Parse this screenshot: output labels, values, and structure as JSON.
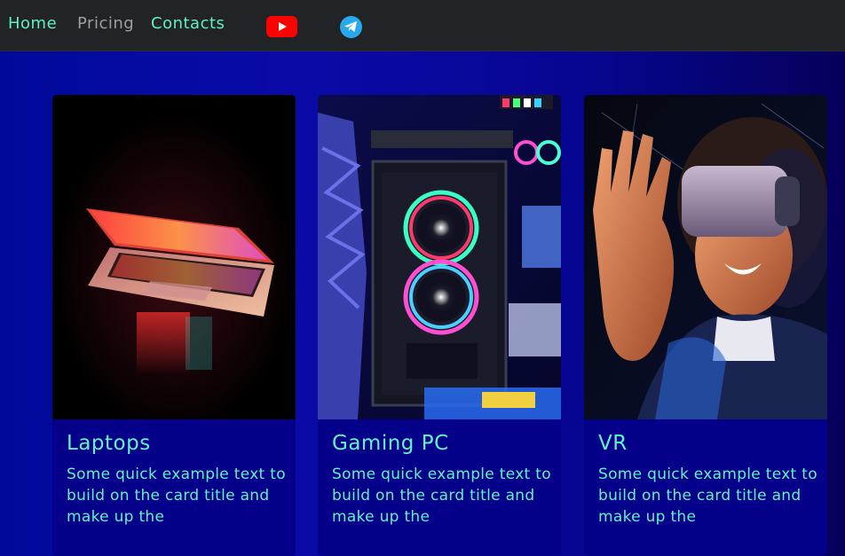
{
  "nav": {
    "home": "Home",
    "pricing": "Pricing",
    "contacts": "Contacts",
    "youtube_icon": "youtube-icon",
    "telegram_icon": "telegram-icon"
  },
  "colors": {
    "accent": "#62f2c8",
    "nav_bg": "#222326",
    "page_bg": "#0a0aa8",
    "card_bg": "#04008a",
    "youtube": "#ff0000",
    "telegram": "#29a9eb"
  },
  "cards": [
    {
      "title": "Laptops",
      "text": "Some quick example text to build on the card title and make up the"
    },
    {
      "title": "Gaming PC",
      "text": "Some quick example text to build on the card title and make up the"
    },
    {
      "title": "VR",
      "text": "Some quick example text to build on the card title and make up the"
    }
  ]
}
